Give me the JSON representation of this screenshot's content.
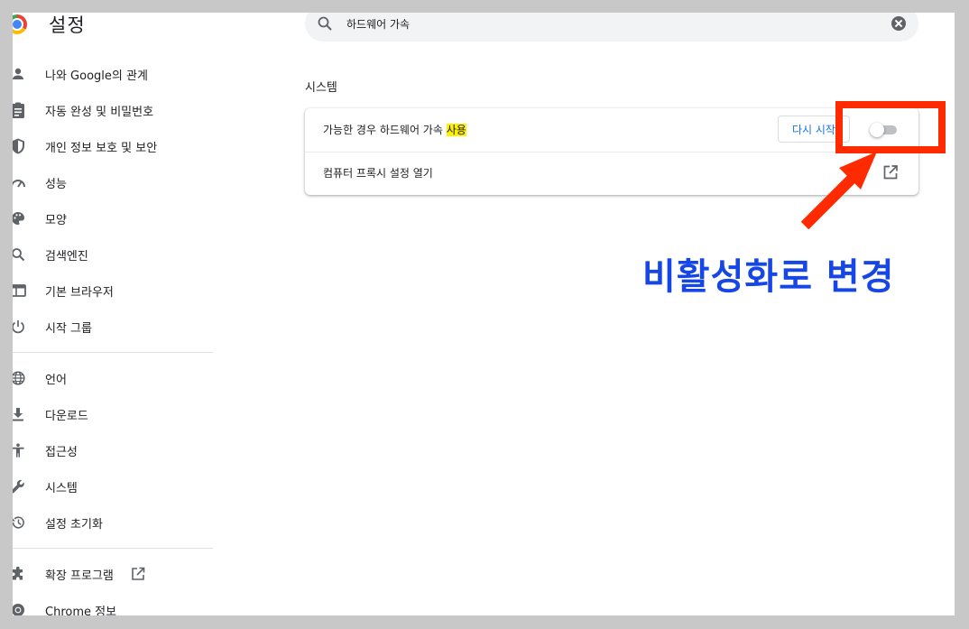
{
  "header": {
    "title": "설정"
  },
  "search": {
    "query": "하드웨어 가속"
  },
  "sidebar": {
    "items": [
      {
        "label": "나와 Google의 관계",
        "icon": "person-icon"
      },
      {
        "label": "자동 완성 및 비밀번호",
        "icon": "clipboard-icon"
      },
      {
        "label": "개인 정보 보호 및 보안",
        "icon": "shield-icon"
      },
      {
        "label": "성능",
        "icon": "speedometer-icon"
      },
      {
        "label": "모양",
        "icon": "palette-icon"
      },
      {
        "label": "검색엔진",
        "icon": "search-icon"
      },
      {
        "label": "기본 브라우저",
        "icon": "browser-icon"
      },
      {
        "label": "시작 그룹",
        "icon": "power-icon"
      }
    ],
    "items2": [
      {
        "label": "언어",
        "icon": "globe-icon"
      },
      {
        "label": "다운로드",
        "icon": "download-icon"
      },
      {
        "label": "접근성",
        "icon": "accessibility-icon"
      },
      {
        "label": "시스템",
        "icon": "wrench-icon"
      },
      {
        "label": "설정 초기화",
        "icon": "history-icon"
      }
    ],
    "items3": [
      {
        "label": "확장 프로그램",
        "icon": "puzzle-icon"
      },
      {
        "label": "Chrome 정보",
        "icon": "chrome-icon"
      }
    ]
  },
  "main": {
    "section_title": "시스템",
    "rows": [
      {
        "label_prefix": "가능한 경우 하드웨어 가속 ",
        "label_highlight": "사용",
        "button_label": "다시 시작",
        "toggle_on": false
      },
      {
        "label": "컴퓨터 프록시 설정 열기"
      }
    ]
  },
  "annotation": {
    "text": "비활성화로 변경",
    "color": "#1646e6",
    "highlight_color": "#ff2a00"
  }
}
